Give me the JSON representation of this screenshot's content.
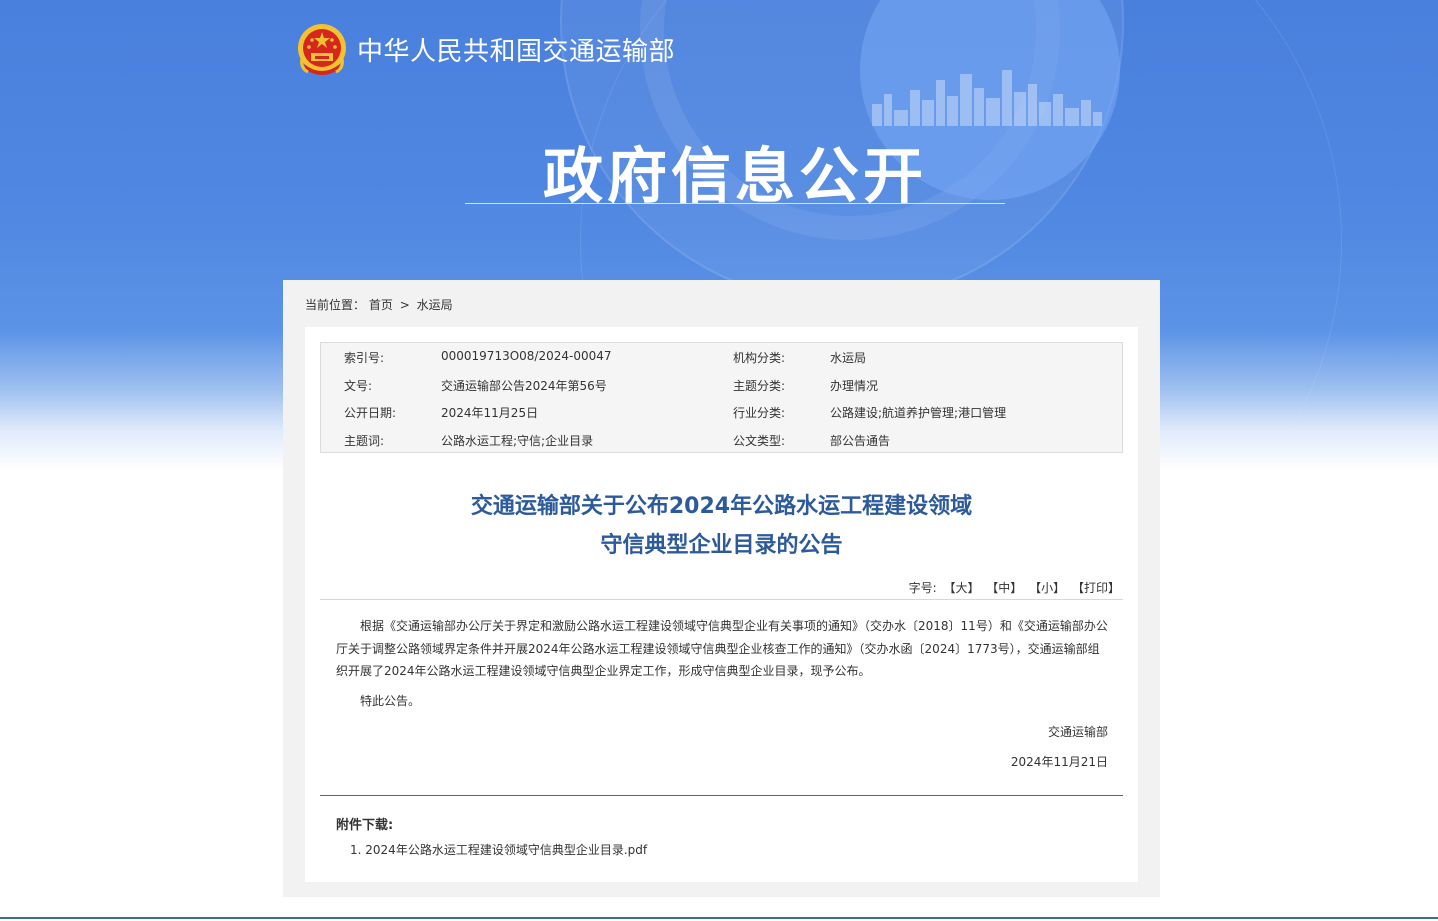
{
  "header": {
    "site_title": "中华人民共和国交通运输部",
    "section_title": "政府信息公开"
  },
  "breadcrumb": {
    "prefix": "当前位置：",
    "home": "首页",
    "separator": ">",
    "current": "水运局"
  },
  "meta": [
    {
      "label1": "索引号:",
      "value1": "000019713O08/2024-00047",
      "label2": "机构分类:",
      "value2": "水运局"
    },
    {
      "label1": "文号:",
      "value1": "交通运输部公告2024年第56号",
      "label2": "主题分类:",
      "value2": "办理情况"
    },
    {
      "label1": "公开日期:",
      "value1": "2024年11月25日",
      "label2": "行业分类:",
      "value2": "公路建设;航道养护管理;港口管理"
    },
    {
      "label1": "主题词:",
      "value1": "公路水运工程;守信;企业目录",
      "label2": "公文类型:",
      "value2": "部公告通告"
    }
  ],
  "document": {
    "title_line1": "交通运输部关于公布2024年公路水运工程建设领域",
    "title_line2": "守信典型企业目录的公告",
    "paragraph1": "根据《交通运输部办公厅关于界定和激励公路水运工程建设领域守信典型企业有关事项的通知》（交办水〔2018〕11号）和《交通运输部办公厅关于调整公路领域界定条件并开展2024年公路水运工程建设领域守信典型企业核查工作的通知》（交办水函〔2024〕1773号），交通运输部组织开展了2024年公路水运工程建设领域守信典型企业界定工作，形成守信典型企业目录，现予公布。",
    "paragraph2": "特此公告。",
    "signature": "交通运输部",
    "signature_date": "2024年11月21日"
  },
  "font_controls": {
    "label": "字号:",
    "large": "【大】",
    "medium": "【中】",
    "small": "【小】",
    "print": "【打印】"
  },
  "attachments": {
    "title": "附件下载:",
    "items": [
      {
        "index": "1.",
        "name": "2024年公路水运工程建设领域守信典型企业目录.pdf"
      }
    ]
  },
  "colors": {
    "hero_blue": "#4f87e2",
    "title_blue": "#2d5a9a",
    "rule_teal": "#3b6d8c"
  }
}
